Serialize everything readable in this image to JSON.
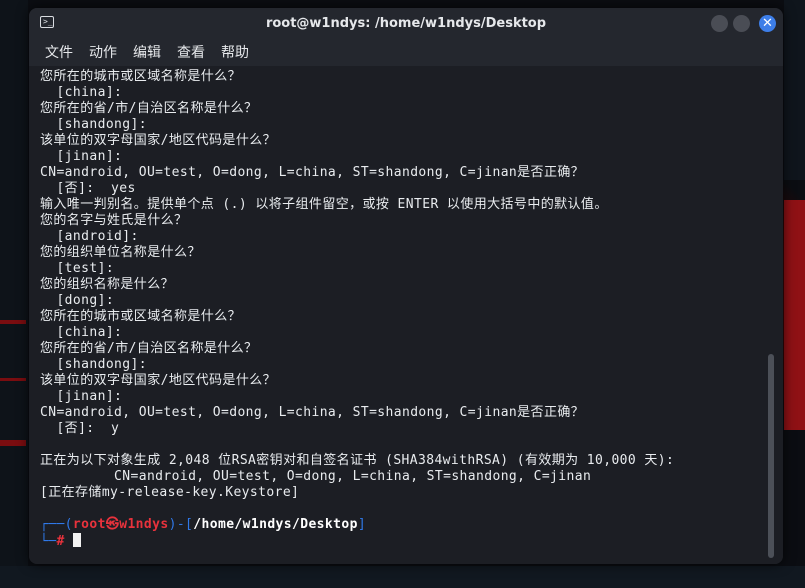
{
  "window": {
    "title": "root@w1ndys: /home/w1ndys/Desktop",
    "close_glyph": "✕"
  },
  "menubar": {
    "items": [
      "文件",
      "动作",
      "编辑",
      "查看",
      "帮助"
    ]
  },
  "terminal": {
    "lines": [
      "您所在的城市或区域名称是什么？",
      "  [china]:",
      "您所在的省/市/自治区名称是什么？",
      "  [shandong]:",
      "该单位的双字母国家/地区代码是什么？",
      "  [jinan]:",
      "CN=android, OU=test, O=dong, L=china, ST=shandong, C=jinan是否正确？",
      "  [否]:  yes",
      "输入唯一判别名。提供单个点 (.) 以将子组件留空，或按 ENTER 以使用大括号中的默认值。",
      "您的名字与姓氏是什么？",
      "  [android]:",
      "您的组织单位名称是什么？",
      "  [test]:",
      "您的组织名称是什么？",
      "  [dong]:",
      "您所在的城市或区域名称是什么？",
      "  [china]:",
      "您所在的省/市/自治区名称是什么？",
      "  [shandong]:",
      "该单位的双字母国家/地区代码是什么？",
      "  [jinan]:",
      "CN=android, OU=test, O=dong, L=china, ST=shandong, C=jinan是否正确？",
      "  [否]:  y",
      "",
      "正在为以下对象生成 2,048 位RSA密钥对和自签名证书 (SHA384withRSA) (有效期为 10,000 天):",
      "         CN=android, OU=test, O=dong, L=china, ST=shandong, C=jinan",
      "[正在存储my-release-key.Keystore]",
      ""
    ],
    "prompt": {
      "corner_top": "┌──(",
      "user_host": "root㉿w1ndys",
      "mid": ")-[",
      "path": "/home/w1ndys/Desktop",
      "end": "]",
      "corner_bottom": "└─",
      "symbol": "#"
    }
  },
  "colors": {
    "prompt_frame": "#2f78e8",
    "prompt_user": "#e8323c",
    "accent_close": "#3d7ee8"
  }
}
